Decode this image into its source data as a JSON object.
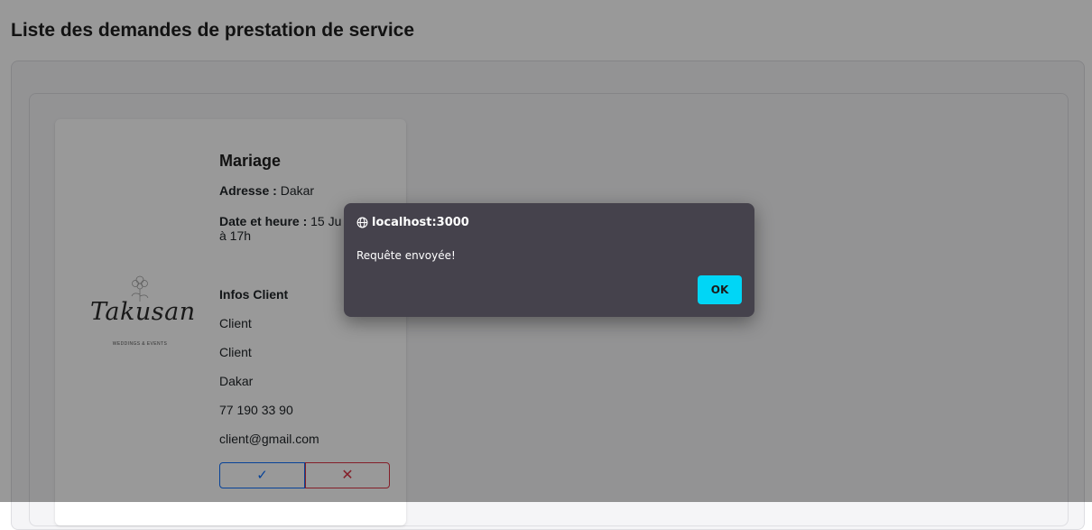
{
  "page": {
    "title": "Liste des demandes de prestation de service"
  },
  "card": {
    "logo": {
      "text": "Takusan",
      "subtitle": "WEDDINGS & EVENTS"
    },
    "event_title": "Mariage",
    "address_label": "Adresse :",
    "address_value": "Dakar",
    "date_label": "Date et heure :",
    "date_value": "15 Ju",
    "time_value": "à 17h",
    "client_section_title": "Infos Client",
    "client_lines": [
      "Client",
      "Client",
      "Dakar",
      "77 190 33 90",
      "client@gmail.com"
    ],
    "accept_icon": "check-icon",
    "accept_glyph": "✓",
    "reject_icon": "close-icon",
    "reject_glyph": "✕"
  },
  "dialog": {
    "origin": "localhost:3000",
    "origin_icon": "globe-icon",
    "message": "Requête envoyée!",
    "ok_label": "OK"
  },
  "colors": {
    "accent_accept": "#0d6efd",
    "accent_reject": "#dc3545",
    "dialog_bg": "#45424c",
    "dialog_button": "#00d6f6"
  }
}
